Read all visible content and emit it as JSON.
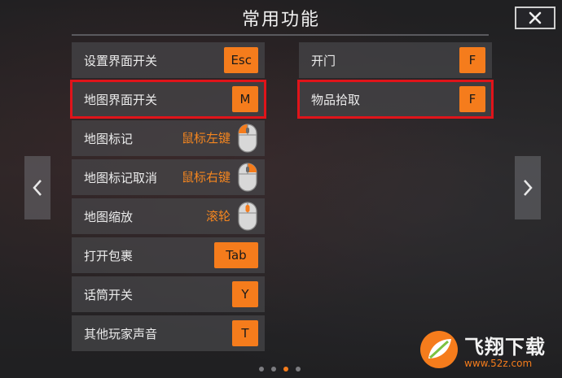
{
  "title": "常用功能",
  "left_column": [
    {
      "label": "设置界面开关",
      "key": "Esc"
    },
    {
      "label": "地图界面开关",
      "key": "M",
      "highlighted": true
    },
    {
      "label": "地图标记",
      "mouse": "鼠标左键",
      "mouse_button": "left"
    },
    {
      "label": "地图标记取消",
      "mouse": "鼠标右键",
      "mouse_button": "right"
    },
    {
      "label": "地图缩放",
      "mouse": "滚轮",
      "mouse_button": "wheel"
    },
    {
      "label": "打开包裹",
      "key": "Tab"
    },
    {
      "label": "话筒开关",
      "key": "Y"
    },
    {
      "label": "其他玩家声音",
      "key": "T"
    }
  ],
  "right_column": [
    {
      "label": "开门",
      "key": "F"
    },
    {
      "label": "物品拾取",
      "key": "F",
      "highlighted": true
    }
  ],
  "pagination": {
    "count": 4,
    "active_index": 2
  },
  "watermark": {
    "title": "飞翔下载",
    "url": "www.52z.com"
  },
  "colors": {
    "accent": "#f57c1c",
    "highlight": "#e0141a"
  }
}
